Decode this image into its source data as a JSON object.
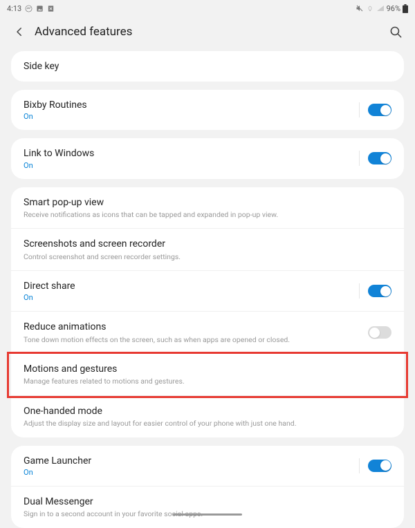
{
  "status": {
    "time": "4:13",
    "battery": "96%"
  },
  "header": {
    "title": "Advanced features"
  },
  "items": {
    "side_key": {
      "title": "Side key"
    },
    "bixby": {
      "title": "Bixby Routines",
      "status": "On"
    },
    "link_windows": {
      "title": "Link to Windows",
      "status": "On"
    },
    "smart_popup": {
      "title": "Smart pop-up view",
      "sub": "Receive notifications as icons that can be tapped and expanded in pop-up view."
    },
    "screenshots": {
      "title": "Screenshots and screen recorder",
      "sub": "Control screenshot and screen recorder settings."
    },
    "direct_share": {
      "title": "Direct share",
      "status": "On"
    },
    "reduce_anim": {
      "title": "Reduce animations",
      "sub": "Tone down motion effects on the screen, such as when apps are opened or closed."
    },
    "motions": {
      "title": "Motions and gestures",
      "sub": "Manage features related to motions and gestures."
    },
    "one_handed": {
      "title": "One-handed mode",
      "sub": "Adjust the display size and layout for easier control of your phone with just one hand."
    },
    "game_launcher": {
      "title": "Game Launcher",
      "status": "On"
    },
    "dual_messenger": {
      "title": "Dual Messenger",
      "sub": "Sign in to a second account in your favorite social apps."
    }
  }
}
